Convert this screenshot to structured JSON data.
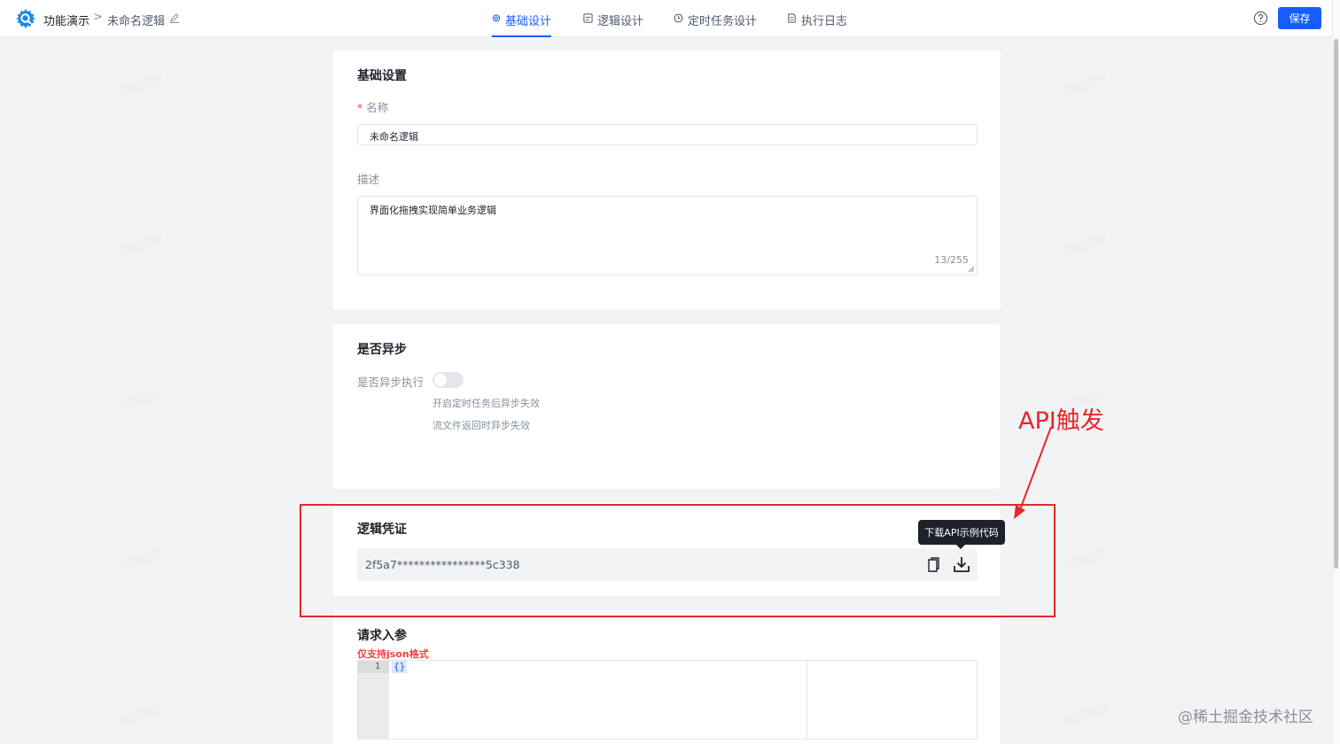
{
  "header": {
    "app_name": "功能演示",
    "separator": ">",
    "logic_name": "未命名逻辑",
    "tabs": [
      {
        "label": "基础设计",
        "active": true,
        "icon": "gear-icon"
      },
      {
        "label": "逻辑设计",
        "active": false,
        "icon": "logic-icon"
      },
      {
        "label": "定时任务设计",
        "active": false,
        "icon": "clock-icon"
      },
      {
        "label": "执行日志",
        "active": false,
        "icon": "document-icon"
      }
    ],
    "save_label": "保存"
  },
  "basic": {
    "title": "基础设置",
    "name_label": "名称",
    "required_mark": "*",
    "name_value": "未命名逻辑",
    "desc_label": "描述",
    "desc_value": "界面化拖拽实现简单业务逻辑",
    "desc_counter": "13/255"
  },
  "async": {
    "title": "是否异步",
    "switch_label": "是否异步执行",
    "switch_on": false,
    "hint1": "开启定时任务后异步失效",
    "hint2": "流文件返回时异步失效"
  },
  "credential": {
    "title": "逻辑凭证",
    "value": "2f5a7****************5c338",
    "tooltip": "下载API示例代码"
  },
  "request": {
    "title": "请求入参",
    "hint": "仅支持json格式",
    "line_number": "1",
    "code": "{}"
  },
  "annotation": {
    "text": "API触发",
    "color": "#e8262b"
  },
  "watermark": "@稀土掘金技术社区",
  "colors": {
    "primary": "#165dff",
    "danger": "#f53f3f",
    "annotation": "#e8262b"
  }
}
